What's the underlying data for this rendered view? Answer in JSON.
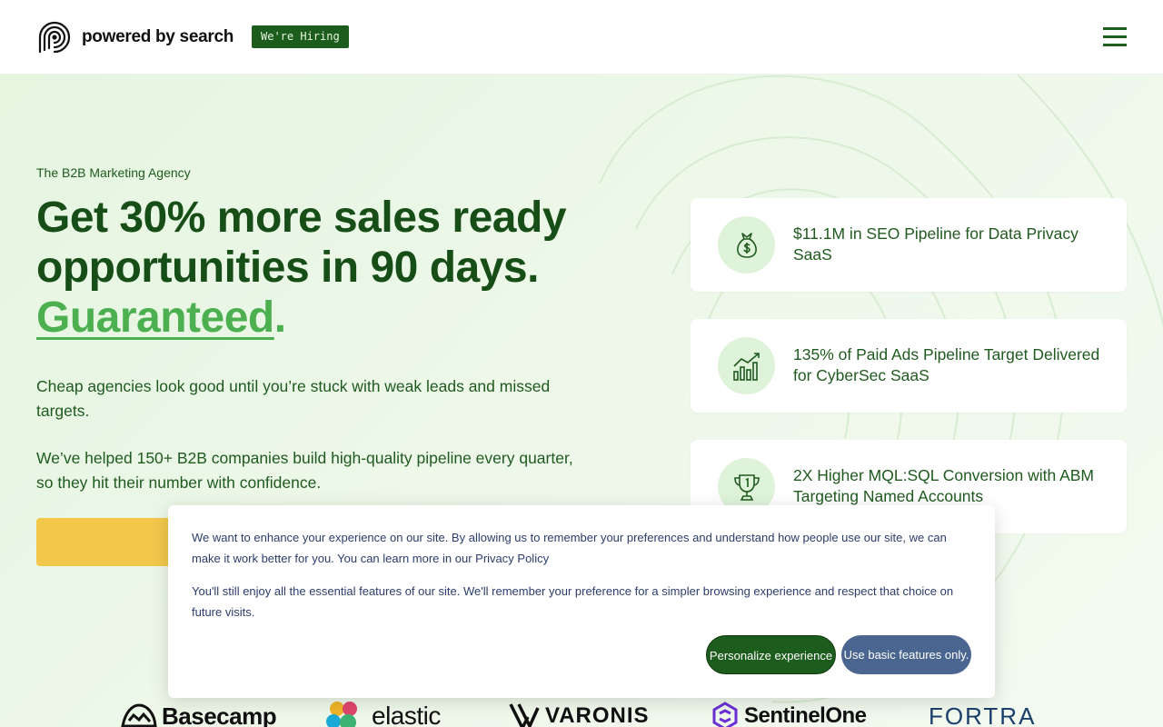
{
  "header": {
    "logo_text": "powered by search",
    "hiring_badge": "We're Hiring",
    "menu_icon": "hamburger-menu-icon"
  },
  "hero": {
    "eyebrow": "The B2B Marketing Agency",
    "headline_part1": "Get 30% more sales ready opportunities in 90 days. ",
    "headline_accent": "Guaranteed",
    "headline_end": ".",
    "paragraph1": "Cheap agencies look good until you’re stuck with weak leads and missed targets.",
    "paragraph2": "We’ve helped 150+ B2B companies build high-quality pipeline every quarter, so they hit their number with confidence.",
    "cta_label": ""
  },
  "stats": [
    {
      "icon": "money-bag-icon",
      "text": "$11.1M in SEO Pipeline for Data Privacy SaaS"
    },
    {
      "icon": "bar-chart-growth-icon",
      "text": "135% of Paid Ads Pipeline Target Delivered for CyberSec SaaS"
    },
    {
      "icon": "trophy-icon",
      "text": "2X Higher MQL:SQL Conversion with ABM Targeting Named Accounts"
    }
  ],
  "logos": [
    "Basecamp",
    "elastic",
    "VARONIS",
    "SentinelOne",
    "FORTRA"
  ],
  "cookie": {
    "text1": "We want to enhance your experience on our site. By allowing us to remember your preferences and understand how people use our site, we can make it work better for you. You can learn more in our ",
    "privacy_link": "Privacy Policy",
    "text2": "You'll still enjoy all the essential features of our site. We'll remember your preference for a simpler browsing experience and respect that choice on future visits.",
    "personalize_label": "Personalize experience",
    "basic_label": "Use basic features only."
  },
  "colors": {
    "brand_green": "#1c5c1c",
    "accent_green": "#4caf50",
    "cta_yellow": "#f2c84b",
    "cookie_blue": "#4a6690"
  }
}
